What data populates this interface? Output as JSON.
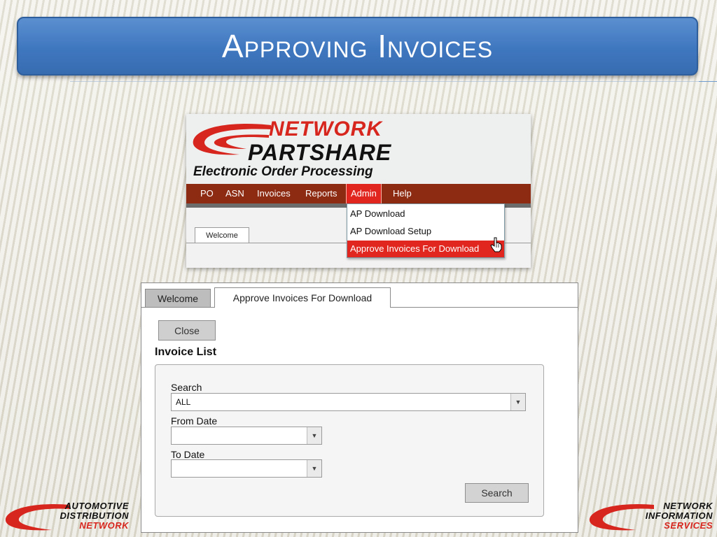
{
  "slide": {
    "title": "Approving Invoices"
  },
  "app_header": {
    "logo_line1": "NETWORK",
    "logo_line2": "PARTSHARE",
    "logo_line3": "Electronic Order Processing"
  },
  "nav": {
    "items": [
      {
        "label": "PO"
      },
      {
        "label": "ASN"
      },
      {
        "label": "Invoices"
      },
      {
        "label": "Reports"
      },
      {
        "label": "Admin",
        "active": true
      },
      {
        "label": "Help"
      }
    ]
  },
  "admin_menu": {
    "items": [
      {
        "label": "AP Download"
      },
      {
        "label": "AP Download Setup"
      },
      {
        "label": "Approve Invoices For Download",
        "highlighted": true
      }
    ]
  },
  "shot1": {
    "welcome_tab": "Welcome"
  },
  "shot2": {
    "tabs": [
      {
        "label": "Welcome"
      },
      {
        "label": "Approve Invoices For Download",
        "active": true
      }
    ],
    "close_label": "Close",
    "heading": "Invoice List",
    "search_label": "Search",
    "search_value": "ALL",
    "from_date_label": "From Date",
    "from_date_value": "",
    "to_date_label": "To Date",
    "to_date_value": "",
    "search_button": "Search"
  },
  "footer": {
    "left": {
      "line1": "Automotive",
      "line2": "Distribution",
      "line3": "Network"
    },
    "right": {
      "line1": "Network",
      "line2": "Information",
      "line3": "Services"
    }
  },
  "colors": {
    "banner": "#3f77bf",
    "nav_bg": "#8d2a12",
    "accent_red": "#e0261e"
  }
}
